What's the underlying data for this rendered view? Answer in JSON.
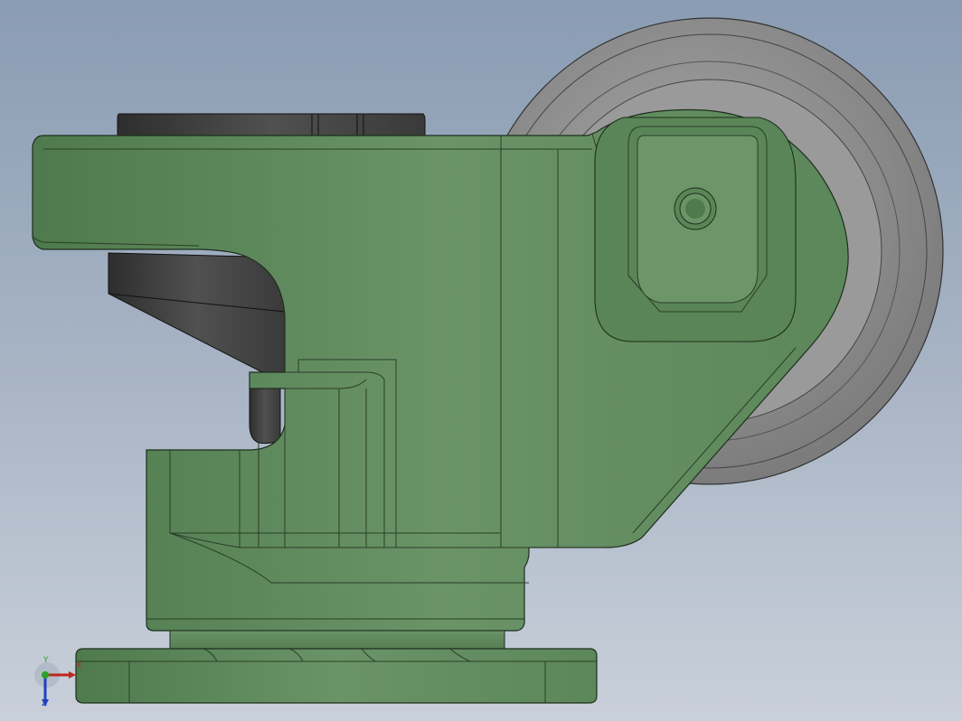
{
  "viewport": {
    "background_top": "#8a9cb3",
    "background_bottom": "#c9d0da"
  },
  "model": {
    "body_color": "#5f8a5d",
    "body_shadow_color": "#4b7149",
    "wheel_color": "#8d8d8d",
    "dark_part_color": "#3b3b3b"
  },
  "triad": {
    "x_label": "X",
    "y_label": "Y",
    "z_label": "Z",
    "x_color": "#c0281e",
    "y_color": "#2aa12a",
    "z_color": "#2040c0"
  }
}
